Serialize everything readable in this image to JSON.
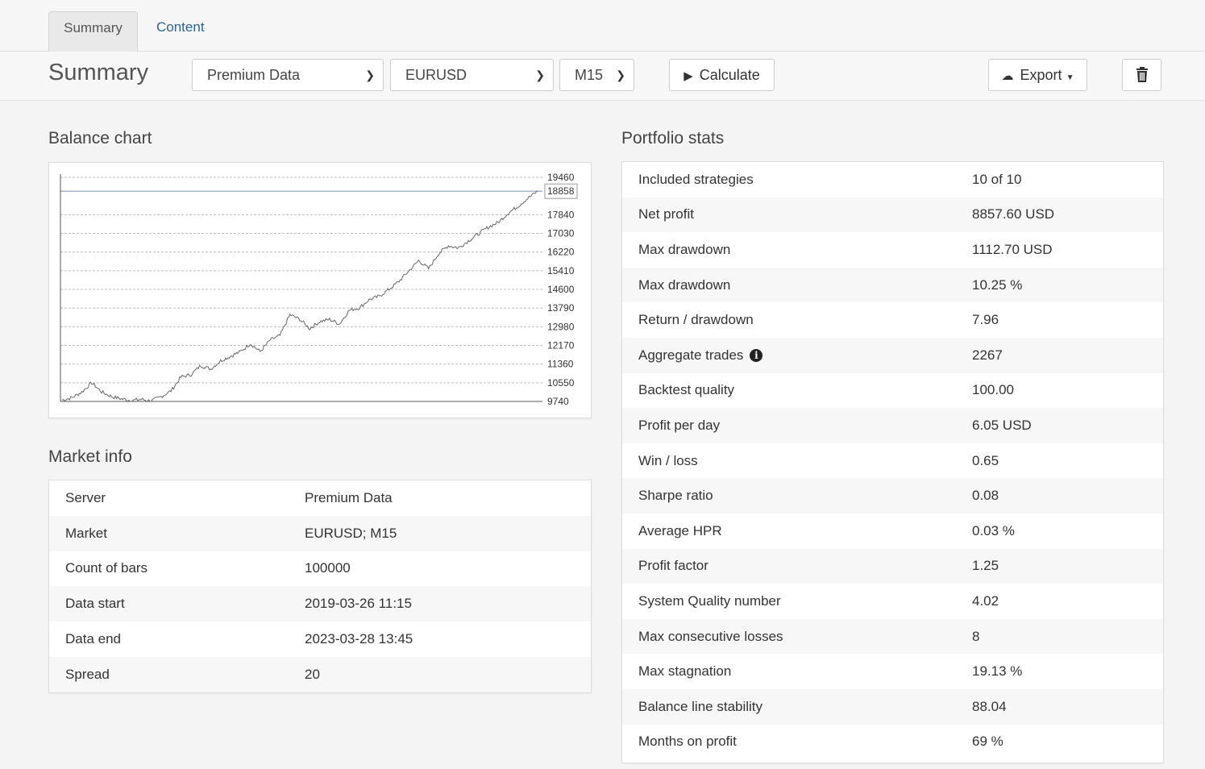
{
  "tabs": [
    {
      "label": "Summary",
      "active": true
    },
    {
      "label": "Content",
      "active": false
    }
  ],
  "toolbar": {
    "title": "Summary",
    "data_source": "Premium Data",
    "symbol": "EURUSD",
    "timeframe": "M15",
    "calculate_label": "Calculate",
    "export_label": "Export",
    "icons": {
      "calculate": "play-icon",
      "export": "cloud-download-icon",
      "delete": "trash-icon",
      "dropdown": "chevron-down-icon"
    }
  },
  "balance_chart": {
    "heading": "Balance chart",
    "current_value_label": "18858"
  },
  "chart_data": {
    "type": "line",
    "title": "",
    "xlabel": "",
    "ylabel": "",
    "ylim": [
      9740,
      19460
    ],
    "y_ticks": [
      "19460",
      "18858",
      "17840",
      "17030",
      "16220",
      "15410",
      "14600",
      "13790",
      "12980",
      "12170",
      "11360",
      "10550",
      "9740"
    ],
    "y_tick_values": [
      19460,
      18858,
      17840,
      17030,
      16220,
      15410,
      14600,
      13790,
      12980,
      12170,
      11360,
      10550,
      9740
    ],
    "grid": true,
    "series": [
      {
        "values": [
          9800,
          9900,
          10150,
          10550,
          10150,
          9950,
          9850,
          9780,
          9830,
          9760,
          9950,
          10200,
          10800,
          10900,
          11300,
          11150,
          11500,
          11700,
          11900,
          12250,
          11900,
          12400,
          12600,
          13500,
          13300,
          12900,
          13200,
          13300,
          13100,
          13700,
          13800,
          14150,
          14300,
          14600,
          14950,
          15400,
          15850,
          15500,
          16150,
          16500,
          16400,
          16700,
          17000,
          17300,
          17500,
          17900,
          18200,
          18550,
          18858
        ]
      }
    ]
  },
  "market_info": {
    "heading": "Market info",
    "rows": [
      {
        "label": "Server",
        "value": "Premium Data"
      },
      {
        "label": "Market",
        "value": "EURUSD; M15"
      },
      {
        "label": "Count of bars",
        "value": "100000"
      },
      {
        "label": "Data start",
        "value": "2019-03-26 11:15"
      },
      {
        "label": "Data end",
        "value": "2023-03-28 13:45"
      },
      {
        "label": "Spread",
        "value": "20"
      }
    ]
  },
  "portfolio_stats": {
    "heading": "Portfolio stats",
    "rows": [
      {
        "label": "Included strategies",
        "value": "10 of 10"
      },
      {
        "label": "Net profit",
        "value": "8857.60 USD"
      },
      {
        "label": "Max drawdown",
        "value": "1112.70 USD"
      },
      {
        "label": "Max drawdown",
        "value": "10.25 %"
      },
      {
        "label": "Return / drawdown",
        "value": "7.96"
      },
      {
        "label": "Aggregate trades",
        "value": "2267",
        "info_icon": true
      },
      {
        "label": "Backtest quality",
        "value": "100.00"
      },
      {
        "label": "Profit per day",
        "value": "6.05 USD"
      },
      {
        "label": "Win / loss",
        "value": "0.65"
      },
      {
        "label": "Sharpe ratio",
        "value": "0.08"
      },
      {
        "label": "Average HPR",
        "value": "0.03 %"
      },
      {
        "label": "Profit factor",
        "value": "1.25"
      },
      {
        "label": "System Quality number",
        "value": "4.02"
      },
      {
        "label": "Max consecutive losses",
        "value": "8"
      },
      {
        "label": "Max stagnation",
        "value": "19.13 %"
      },
      {
        "label": "Balance line stability",
        "value": "88.04"
      },
      {
        "label": "Months on profit",
        "value": "69 %"
      }
    ]
  }
}
